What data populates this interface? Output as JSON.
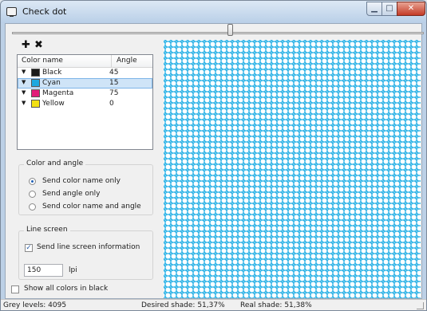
{
  "window": {
    "title": "Check dot"
  },
  "toolbar": {
    "add_label": "✚",
    "remove_label": "✖"
  },
  "color_list": {
    "headers": {
      "name": "Color name",
      "angle": "Angle"
    },
    "rows": [
      {
        "name": "Black",
        "angle": "45",
        "swatch": "#1a1a1a",
        "selected": false
      },
      {
        "name": "Cyan",
        "angle": "15",
        "swatch": "#1ea8df",
        "selected": true
      },
      {
        "name": "Magenta",
        "angle": "75",
        "swatch": "#e21c79",
        "selected": false
      },
      {
        "name": "Yellow",
        "angle": "0",
        "swatch": "#f2e013",
        "selected": false
      }
    ]
  },
  "color_and_angle": {
    "legend": "Color and angle",
    "options": [
      {
        "label": "Send color name only",
        "checked": true
      },
      {
        "label": "Send angle only",
        "checked": false
      },
      {
        "label": "Send color name and angle",
        "checked": false
      }
    ]
  },
  "line_screen": {
    "legend": "Line screen",
    "send_info_label": "Send line screen information",
    "send_info_checked": true,
    "lpi_value": "150",
    "lpi_unit": "lpi"
  },
  "show_all_black": {
    "label": "Show all colors in black",
    "checked": false
  },
  "status": {
    "grey_levels": "Grey levels: 4095",
    "desired_shade": "Desired shade: 51,37%",
    "real_shade": "Real shade: 51,38%"
  },
  "preview": {
    "dot_color": "#2fb3e6",
    "background": "#ffffff"
  }
}
